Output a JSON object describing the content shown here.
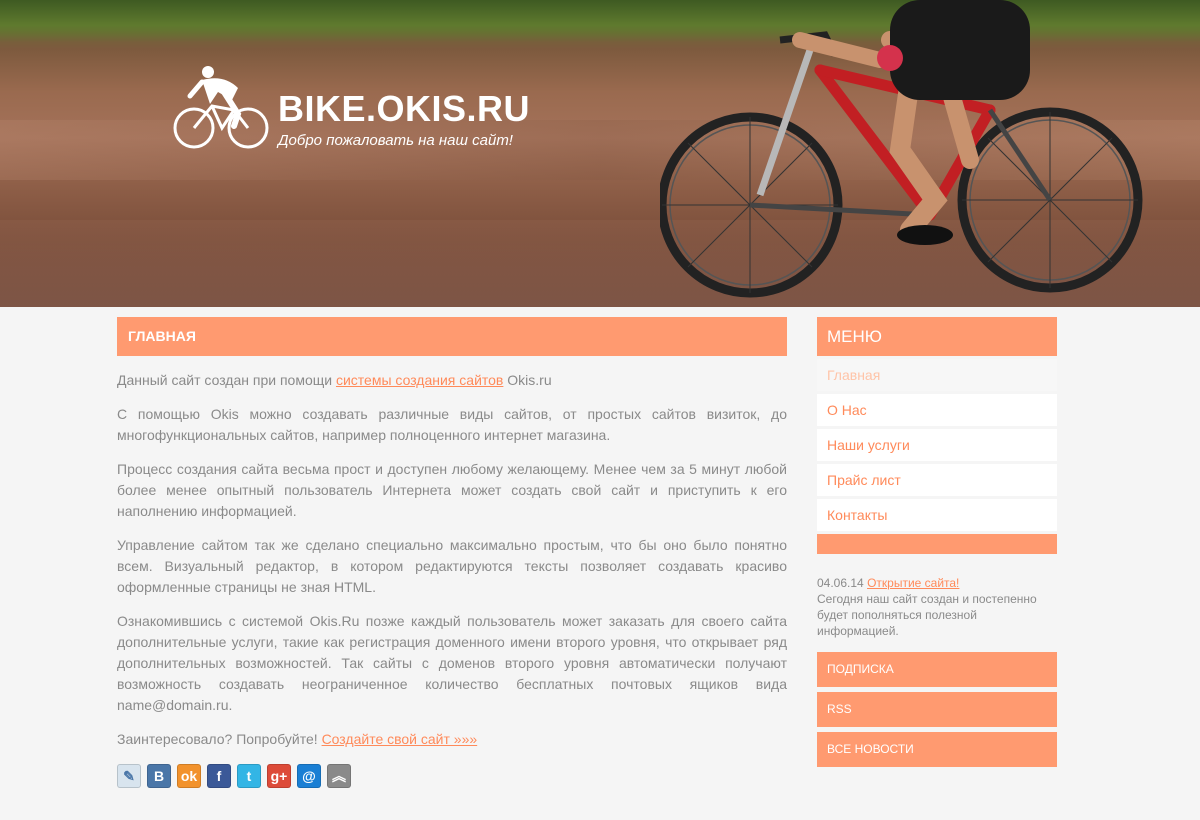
{
  "header": {
    "site_title": "BIKE.OKIS.RU",
    "subtitle": "Добро пожаловать на наш сайт!"
  },
  "main": {
    "page_title": "ГЛАВНАЯ",
    "p1_before": "Данный сайт создан при помощи ",
    "p1_link": "системы создания сайтов",
    "p1_after": " Okis.ru",
    "p2": "С помощью Okis можно создавать различные виды сайтов, от простых сайтов визиток, до многофункциональных сайтов, например полноценного интернет магазина.",
    "p3": "Процесс создания сайта весьма прост и доступен любому желающему. Менее чем за 5 минут любой более менее опытный пользователь Интернета может создать свой сайт и приступить к его наполнению информацией.",
    "p4": "Управление сайтом так же сделано специально максимально простым, что бы оно было понятно всем. Визуальный редактор, в котором редактируются тексты позволяет создавать красиво оформленные страницы не зная HTML.",
    "p5": "Ознакомившись с системой Okis.Ru позже каждый пользователь может заказать для своего сайта дополнительные услуги, такие как регистрация доменного имени второго уровня, что открывает ряд дополнительных возможностей. Так сайты с доменов второго уровня автоматически получают возможность создавать неограниченное количество бесплатных почтовых ящиков вида name@domain.ru.",
    "p6_before": "Заинтересовало? Попробуйте! ",
    "p6_link": "Создайте свой сайт »»»",
    "share": [
      {
        "icon": "livejournal-icon",
        "glyph": "✎",
        "color": "#d8e4ee"
      },
      {
        "icon": "vkontakte-icon",
        "glyph": "В",
        "color": "#4a76a8"
      },
      {
        "icon": "odnoklassniki-icon",
        "glyph": "ok",
        "color": "#f2922c"
      },
      {
        "icon": "facebook-icon",
        "glyph": "f",
        "color": "#3b5998"
      },
      {
        "icon": "twitter-icon",
        "glyph": "t",
        "color": "#33b5e5"
      },
      {
        "icon": "google-plus-icon",
        "glyph": "g+",
        "color": "#dd4b39"
      },
      {
        "icon": "mail-ru-icon",
        "glyph": "@",
        "color": "#1a7fd4"
      },
      {
        "icon": "more-icon",
        "glyph": "︽",
        "color": "#8a8a8a"
      }
    ]
  },
  "sidebar": {
    "menu_title": "МЕНЮ",
    "items": [
      {
        "label": "Главная",
        "active": true
      },
      {
        "label": "О Нас"
      },
      {
        "label": "Наши услуги"
      },
      {
        "label": "Прайс лист"
      },
      {
        "label": "Контакты"
      }
    ],
    "news_date": "04.06.14",
    "news_link": "Открытие сайта!",
    "news_text": "Сегодня наш сайт создан и постепенно будет пополняться полезной информацией.",
    "buttons": [
      "ПОДПИСКА",
      "RSS",
      "ВСЕ НОВОСТИ"
    ]
  },
  "colors": {
    "accent": "#ff9a70",
    "link": "#ff8a5a",
    "text": "#8a8a8a",
    "background": "#f5f5f5"
  }
}
